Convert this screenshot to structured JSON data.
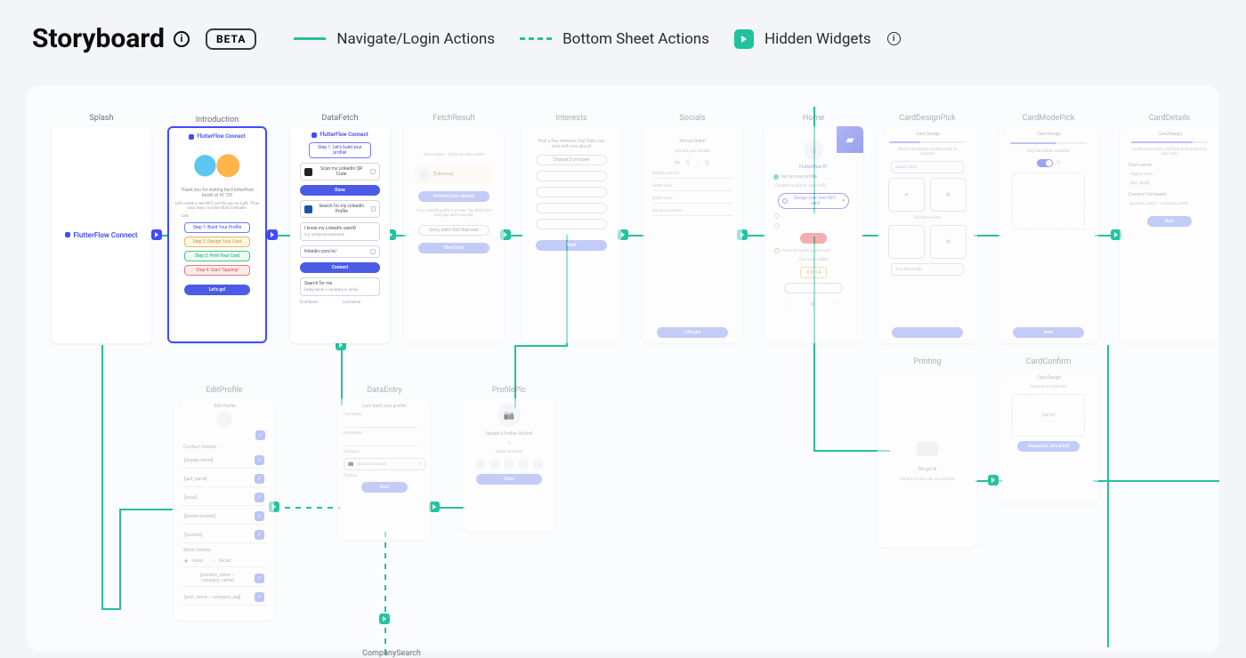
{
  "header": {
    "title": "Storyboard",
    "beta": "BETA",
    "legend": {
      "navigate": "Navigate/Login Actions",
      "bottom_sheet": "Bottom Sheet Actions",
      "hidden": "Hidden Widgets"
    }
  },
  "brand": "FlutterFlow Connect",
  "screens": {
    "splash": {
      "label": "Splash"
    },
    "introduction": {
      "label": "Introduction",
      "step_pill": "Step 1: Let's build your profile!",
      "thanks": "Thank you for visiting the FlutterFlow booth at FF '23!",
      "subtitle": "Let's create a new NFC card for you as a gift. Three easy steps, no more than 5 minutes.",
      "link_label": "Link",
      "steps": {
        "s1": "Step 1: Build Your Profile",
        "s2": "Step 2: Design Your Card",
        "s3": "Step 3: Print Your Card",
        "s4": "Step 4: Start Tapping!"
      },
      "cta": "Let's go!"
    },
    "datafetch": {
      "label": "DataFetch",
      "step_pill": "Step 1: Let's build your profile!",
      "scan_qr": "Scan my LinkedIn QR Code",
      "done": "Done",
      "search_profile": "Search for my LinkedIn Profile",
      "know_id": "I know my LinkedIn userID",
      "placeholder": "e.g. company-username",
      "url_prefix": "linkedin.com/in/",
      "connect": "Connect",
      "search_for_me": "Search for me",
      "search_hint": "Using name + company or email",
      "first_name": "First Name",
      "last_name": "Last Name"
    },
    "fetchresult": {
      "label": "FetchResult",
      "wait": "Almost there... this'll can take a while",
      "name": "[fullname]",
      "fetched": "Fetched your details!",
      "warn": "Your LinkedIn profile is private. Tap Start Over and input data manually.",
      "nope": "Sorry, didn't find that one!",
      "start_over": "Start Over"
    },
    "interests": {
      "label": "Interests",
      "heading": "Pick a few interests that folks can chat with you about!",
      "chips": [
        "Choose 3 or more!",
        "",
        "",
        "",
        ""
      ],
      "next": "Next"
    },
    "socials": {
      "label": "Socials",
      "heading": "Almost there!",
      "sub": "Let's link your socials!",
      "rows": {
        "linkedin": "linkedin.com/in/",
        "twitter": "twitter.com/",
        "github": "github.com/",
        "discord": "discord username"
      },
      "cta": "Let's go!"
    },
    "home": {
      "label": "Home",
      "brand_badge": "FlutterFlow FF",
      "set_up": "Set up your profile",
      "complete": "Complete profile to unlock NFC",
      "design": "Design your own NFC card",
      "come_by": "Come by to pick up your card",
      "your_card": "Your card number",
      "num": "4 8 14"
    },
    "carddesignpick": {
      "label": "CardDesignPick",
      "title": "Card Design",
      "question": "Which card design would you like to choose?",
      "search_ph": "Search name",
      "your_name": "Your Name Here"
    },
    "cardmodepick": {
      "label": "CardModePick",
      "title": "Card Design",
      "only_dark": "Only Dark Mode available!",
      "count": "12",
      "next": "Next"
    },
    "carddetails": {
      "label": "CardDetails",
      "title": "Card Design",
      "confirm": "Confirm the details you'd like to be printed on your card.",
      "fields": {
        "first": "First name",
        "display": "Display name",
        "last": "[last_name]",
        "company": "Current Company",
        "position": "[position_name — company_name]"
      },
      "next": "Next"
    },
    "editprofile": {
      "label": "EditProfile",
      "title": "Edit Profile",
      "sections": {
        "contact": "Contact Details",
        "work": "Work Details"
      },
      "fields": {
        "display": "[display name]",
        "lastname": "[last_name]",
        "email": "[email]",
        "phone": "[phone number]",
        "location": "[location]",
        "switch1": "Guest",
        "switch2": "Social",
        "position": "[position_name — company_name]",
        "username": "[your_name — company_tag]"
      }
    },
    "dataentry": {
      "label": "DataEntry",
      "heading": "Let's build your profile!",
      "first": "First Name",
      "last": "Last Name",
      "company": "Company",
      "search_ph": "Quickstart search",
      "position": "Position",
      "next": "Next"
    },
    "profilepic": {
      "label": "ProfilePic",
      "upload": "Upload a Profile Picture!",
      "or": "or",
      "select": "Select an Avatar",
      "done": "Done"
    },
    "printing": {
      "label": "Printing",
      "got_it": "We got it!",
      "sub": "Come by to see your card printed."
    },
    "cardconfirm": {
      "label": "CardConfirm",
      "title": "Card Design",
      "how": "Here's how it will look!",
      "name": "[name]",
      "cta": "Awesome, let's print!"
    },
    "companysearch": {
      "label": "CompanySearch"
    }
  }
}
